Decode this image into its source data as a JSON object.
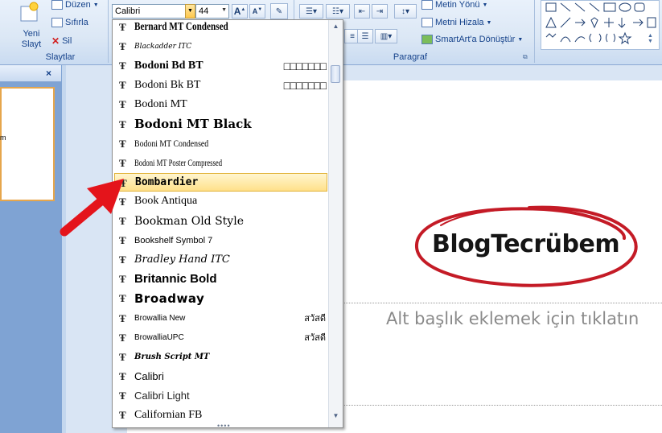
{
  "ribbon": {
    "slides_group": {
      "label": "Slaytlar",
      "new_slide": "Yeni Slayt",
      "layout": "Düzen",
      "reset": "Sıfırla",
      "delete": "Sil"
    },
    "font": {
      "name": "Calibri",
      "size": "44"
    },
    "paragraph_group": {
      "label": "Paragraf",
      "text_direction": "Metin Yönü",
      "align_text": "Metni Hizala",
      "smartart": "SmartArt'a Dönüştür"
    }
  },
  "font_list": {
    "items": [
      {
        "name": "Bernard MT Condensed",
        "preview": ""
      },
      {
        "name": "Blackadder ITC",
        "preview": ""
      },
      {
        "name": "Bodoni Bd BT",
        "preview": "□□□□□□□"
      },
      {
        "name": "Bodoni Bk BT",
        "preview": "□□□□□□□"
      },
      {
        "name": "Bodoni MT",
        "preview": ""
      },
      {
        "name": "Bodoni MT Black",
        "preview": ""
      },
      {
        "name": "Bodoni MT Condensed",
        "preview": ""
      },
      {
        "name": "Bodoni MT Poster Compressed",
        "preview": ""
      },
      {
        "name": "Bombardier",
        "preview": ""
      },
      {
        "name": "Book Antiqua",
        "preview": ""
      },
      {
        "name": "Bookman Old Style",
        "preview": ""
      },
      {
        "name": "Bookshelf Symbol 7",
        "preview": ""
      },
      {
        "name": "Bradley Hand ITC",
        "preview": ""
      },
      {
        "name": "Britannic Bold",
        "preview": ""
      },
      {
        "name": "Broadway",
        "preview": ""
      },
      {
        "name": "Browallia New",
        "preview": "สวัสดี"
      },
      {
        "name": "BrowalliaUPC",
        "preview": "สวัสดี"
      },
      {
        "name": "Brush Script MT",
        "preview": ""
      },
      {
        "name": "Calibri",
        "preview": ""
      },
      {
        "name": "Calibri Light",
        "preview": ""
      },
      {
        "name": "Californian FB",
        "preview": ""
      }
    ],
    "selected": "Bombardier"
  },
  "slide": {
    "logo_text": "BlogTecrübem",
    "subtitle_placeholder": "Alt başlık eklemek için tıklatın"
  },
  "colors": {
    "selection_highlight": "#ffe08a",
    "arrow": "#e4141b",
    "logo_ring": "#c41b26"
  }
}
